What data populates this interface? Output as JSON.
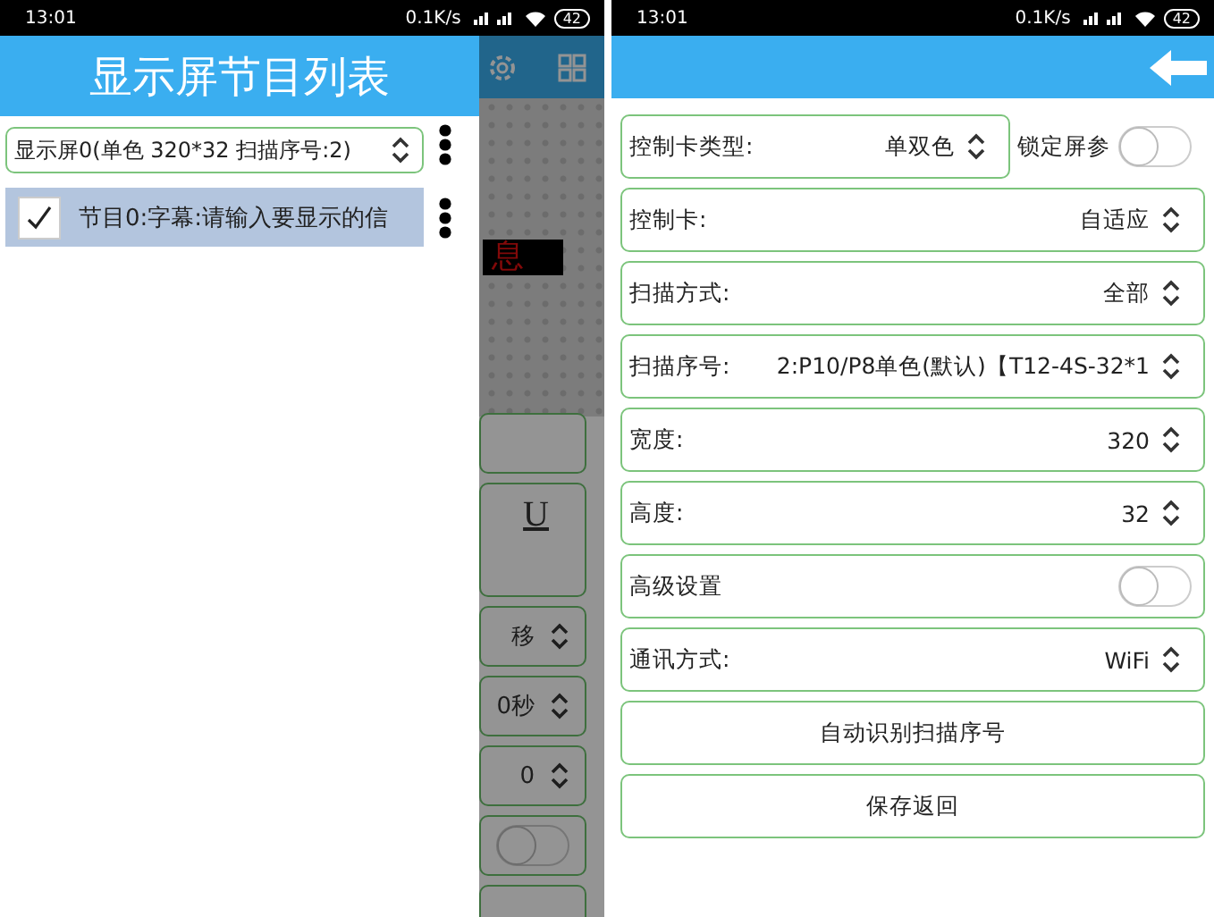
{
  "left_screen": {
    "status_bar": {
      "time": "13:01",
      "speed": "0.1K/s",
      "battery": "42"
    },
    "drawer": {
      "title": "显示屏节目列表",
      "screen_select": {
        "value": "显示屏0(单色 320*32 扫描序号:2)"
      },
      "programs": [
        {
          "label": "节目0:字幕:请输入要显示的信",
          "checked": true,
          "selected": true
        }
      ]
    },
    "background": {
      "preview_text": "息",
      "rows": [
        {
          "kind": "blank"
        },
        {
          "kind": "style",
          "text": "U"
        },
        {
          "kind": "select",
          "text": "移"
        },
        {
          "kind": "select",
          "text": "0秒"
        },
        {
          "kind": "select",
          "text": "0"
        },
        {
          "kind": "toggle",
          "on": false
        },
        {
          "kind": "blank"
        }
      ]
    }
  },
  "right_screen": {
    "status_bar": {
      "time": "13:01",
      "speed": "0.1K/s",
      "battery": "42"
    },
    "lock": {
      "label": "锁定屏参",
      "on": false
    },
    "fields": [
      {
        "kind": "select",
        "label": "控制卡类型:",
        "value": "单双色"
      },
      {
        "kind": "select",
        "label": "控制卡:",
        "value": "自适应"
      },
      {
        "kind": "select",
        "label": "扫描方式:",
        "value": "全部"
      },
      {
        "kind": "select",
        "label": "扫描序号:",
        "value": "2:P10/P8单色(默认)【T12-4S-32*1"
      },
      {
        "kind": "select",
        "label": "宽度:",
        "value": "320"
      },
      {
        "kind": "select",
        "label": "高度:",
        "value": "32"
      },
      {
        "kind": "toggle",
        "label": "高级设置",
        "on": false
      },
      {
        "kind": "select",
        "label": "通讯方式:",
        "value": "WiFi"
      }
    ],
    "buttons": [
      "自动识别扫描序号",
      "保存返回"
    ]
  }
}
